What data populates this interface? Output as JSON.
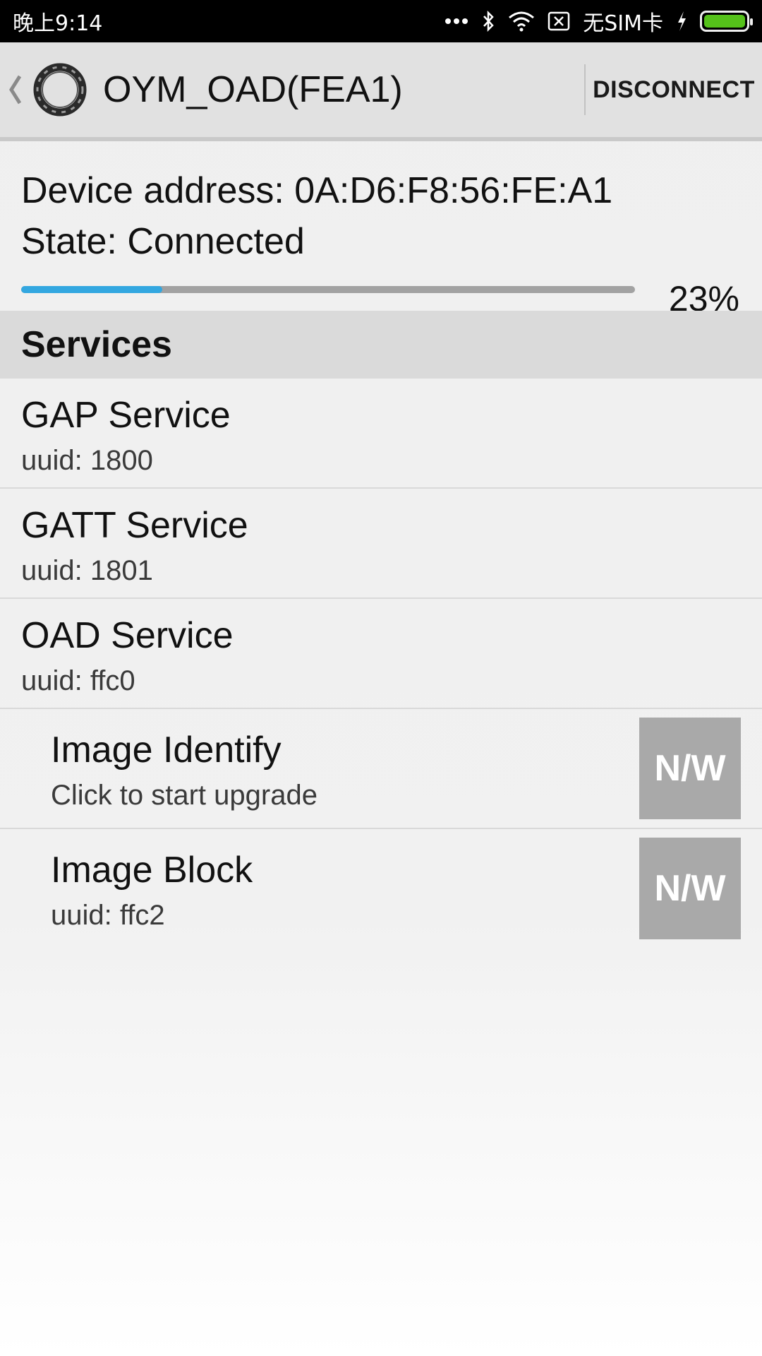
{
  "status_bar": {
    "time": "晚上9:14",
    "carrier": "无SIM卡",
    "icons": [
      "more-dots-icon",
      "bluetooth-icon",
      "wifi-icon",
      "no-sim-icon",
      "charging-icon",
      "battery-icon"
    ],
    "battery_color": "#55c21a"
  },
  "action_bar": {
    "title": "OYM_OAD(FEA1)",
    "disconnect_label": "DISCONNECT"
  },
  "device": {
    "address": "Device address: 0A:D6:F8:56:FE:A1",
    "state": "State: Connected",
    "progress_percent": 23,
    "progress_text": "23%",
    "progress_color": "#33a7e0"
  },
  "services_header": "Services",
  "services": [
    {
      "name": "GAP Service",
      "uuid": "uuid: 1800"
    },
    {
      "name": "GATT Service",
      "uuid": "uuid: 1801"
    },
    {
      "name": "OAD Service",
      "uuid": "uuid: ffc0"
    }
  ],
  "characteristics": [
    {
      "name": "Image Identify",
      "subtitle": "Click to start upgrade",
      "button": "N/W"
    },
    {
      "name": "Image Block",
      "subtitle": "uuid: ffc2",
      "button": "N/W"
    }
  ]
}
